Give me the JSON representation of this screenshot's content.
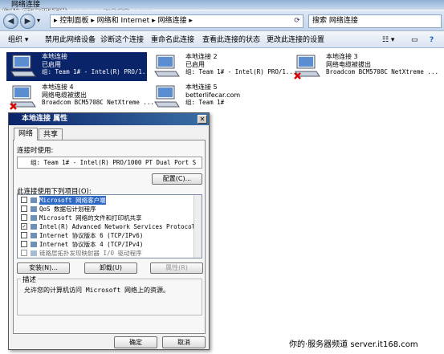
{
  "window": {
    "title": "网络连接"
  },
  "watermark_top": "你的·服务器频道 server.it168.com",
  "watermark_bottom": "你的·服务器频道  server.it168.com",
  "address": {
    "path": "▸ 控制面板 ▸ 网络和 Internet ▸ 网络连接 ▸",
    "search_placeholder": "搜索 网络连接"
  },
  "toolbar": {
    "organize": "组织 ▾",
    "disable": "禁用此网络设备",
    "diagnose": "诊断这个连接",
    "rename": "重命名此连接",
    "status": "查看此连接的状态",
    "settings": "更改此连接的设置"
  },
  "connections": [
    {
      "name": "本地连接",
      "status": "已启用",
      "device": "组: Team 1# - Intel(R) PRO/1...",
      "selected": true,
      "error": false
    },
    {
      "name": "本地连接 2",
      "status": "已启用",
      "device": "组: Team 1# - Intel(R) PRO/1...",
      "selected": false,
      "error": false
    },
    {
      "name": "本地连接 3",
      "status": "网络电缆被拔出",
      "device": "Broadcom BCM5708C NetXtreme ...",
      "selected": false,
      "error": true
    },
    {
      "name": "本地连接 4",
      "status": "网络电缆被拔出",
      "device": "Broadcom BCM5708C NetXtreme ...",
      "selected": false,
      "error": true
    },
    {
      "name": "本地连接 5",
      "status": "betterlifecar.com",
      "device": "组: Team 1#",
      "selected": false,
      "error": false
    }
  ],
  "dialog": {
    "title": "本地连接 属性",
    "tabs": [
      "网络",
      "共享"
    ],
    "connect_using_label": "连接时使用:",
    "adapter": "组: Team 1# - Intel(R) PRO/1000 PT Dual Port S",
    "configure_button": "配置(C)...",
    "items_label": "此连接使用下列项目(O):",
    "items": [
      {
        "label": "Microsoft 网络客户端",
        "checked": false
      },
      {
        "label": "QoS 数据包计划程序",
        "checked": false
      },
      {
        "label": "Microsoft 网络的文件和打印机共享",
        "checked": false
      },
      {
        "label": "Intel(R) Advanced Network Services Protocol",
        "checked": true
      },
      {
        "label": "Internet 协议版本 6 (TCP/IPv6)",
        "checked": false
      },
      {
        "label": "Internet 协议版本 4 (TCP/IPv4)",
        "checked": false
      },
      {
        "label": "链路层拓扑发现映射器 I/O 驱动程序",
        "checked": false
      }
    ],
    "install_button": "安装(N)...",
    "uninstall_button": "卸载(U)",
    "properties_button": "属性(R)",
    "description_label": "描述",
    "description_text": "允许您的计算机访问 Microsoft 网络上的资源。",
    "ok_button": "确定",
    "cancel_button": "取消"
  }
}
